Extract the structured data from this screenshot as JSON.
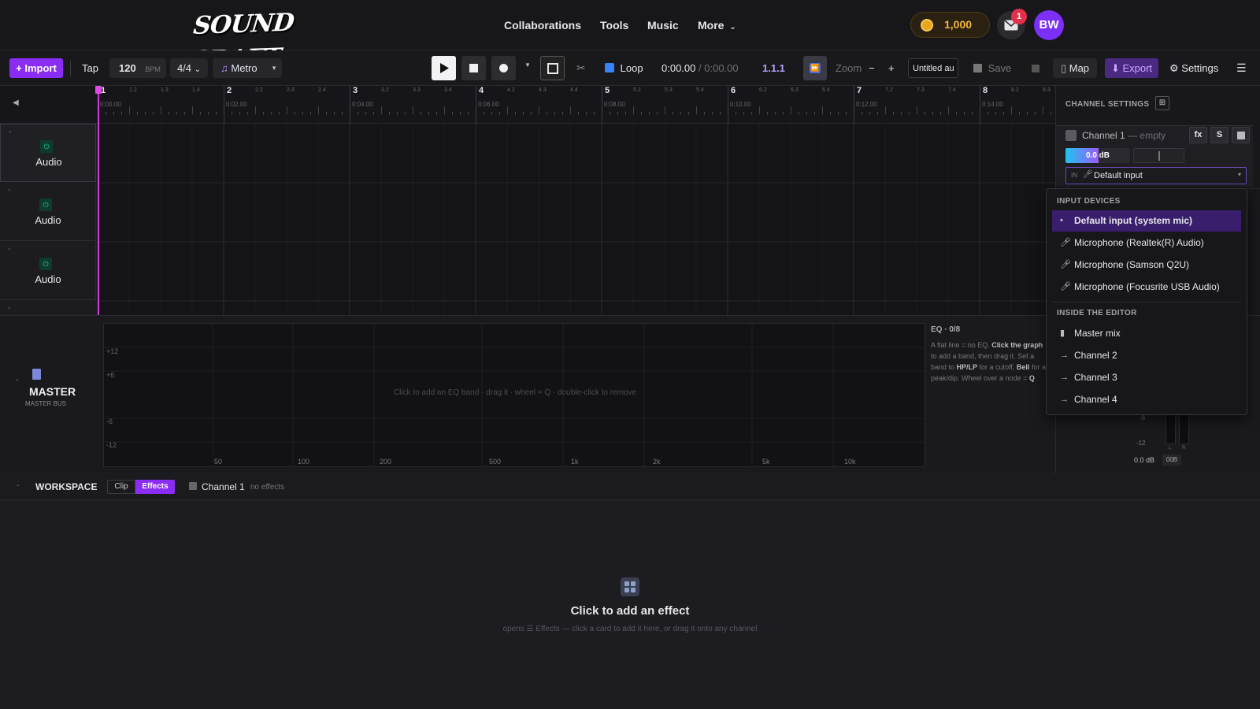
{
  "header": {
    "logo": "SOUND CRAFT",
    "nav": [
      "Collaborations",
      "Tools",
      "Music",
      "More"
    ],
    "coins": "1,000",
    "notifications": "1",
    "avatar": "BW"
  },
  "toolbar": {
    "import": "+ Import",
    "tap": "Tap",
    "bpm": "120",
    "bpm_unit": "BPM",
    "time_signature": "4/4",
    "metro": "Metro",
    "loop": "Loop",
    "time_current": "0:00.00",
    "time_sep": "/",
    "time_total": "0:00.00",
    "position": "1.1.1",
    "zoom": "Zoom",
    "zoom_out": "−",
    "zoom_in": "+",
    "project_name": "Untitled au",
    "save": "Save",
    "map": "Map",
    "export": "Export",
    "settings": "Settings"
  },
  "ruler": {
    "bars": [
      "1",
      "2",
      "3",
      "4",
      "5",
      "6",
      "7",
      "8"
    ],
    "subbeats": [
      "1.2",
      "1.3",
      "1.4",
      "2.2",
      "2.3",
      "2.4",
      "3.2",
      "3.3",
      "3.4",
      "4.2",
      "4.3",
      "4.4",
      "5.2",
      "5.3",
      "5.4",
      "6.2",
      "6.3",
      "6.4",
      "7.2",
      "7.3",
      "7.4",
      "8.2",
      "8.3"
    ],
    "times": [
      "0:00.00",
      "0:02.00",
      "0:04.00",
      "0:06.00",
      "0:08.00",
      "0:10.00",
      "0:12.00",
      "0:14.00"
    ],
    "collapse_arrow": "◀"
  },
  "tracks": [
    {
      "label": "Audio"
    },
    {
      "label": "Audio"
    },
    {
      "label": "Audio"
    }
  ],
  "channel_settings": {
    "title": "CHANNEL SETTINGS",
    "channel_name": "Channel 1",
    "channel_state": "— empty",
    "fx": "fx",
    "solo": "S",
    "volume": "0.0 dB",
    "input_prefix": "IN",
    "input_value": "Default input"
  },
  "input_dropdown": {
    "section1": "INPUT DEVICES",
    "devices": [
      "Default input (system mic)",
      "Microphone (Realtek(R) Audio)",
      "Microphone (Samson Q2U)",
      "Microphone (Focusrite USB Audio)"
    ],
    "section2": "INSIDE THE EDITOR",
    "editor_sources": [
      "Master mix",
      "Channel 2",
      "Channel 3",
      "Channel 4"
    ]
  },
  "master": {
    "title": "MASTER",
    "subtitle": "MASTER BUS",
    "eq_y_labels": [
      "+12",
      "+6",
      "-6",
      "-12"
    ],
    "eq_x_labels": [
      "50",
      "100",
      "200",
      "500",
      "1k",
      "2k",
      "5k",
      "10k"
    ],
    "eq_hint_line": "Click to add an EQ band · drag it · wheel = Q · double-click to remove",
    "eq_title": "EQ · 0/8",
    "eq_help": {
      "t1": "A flat line = no EQ. ",
      "b1": "Click the graph",
      "t2": " to add a band, then drag it. Set a band to ",
      "b2": "HP/LP",
      "t3": " for a cutoff, ",
      "b3": "Bell",
      "t4": " for a peak/dip. Wheel over a node = ",
      "b4": "Q"
    },
    "meter_labels": [
      "-6",
      "-12"
    ],
    "meter_lr": [
      "L",
      "R"
    ],
    "master_volume": "0.0 dB",
    "master_btn": "00B"
  },
  "workspace": {
    "title": "WORKSPACE",
    "tab_clip": "Clip",
    "tab_effects": "Effects",
    "channel": "Channel 1",
    "channel_state": "no effects",
    "empty_title": "Click to add an effect",
    "empty_hint": "opens ☰ Effects — click a card to add it here, or drag it onto any channel"
  },
  "colors": {
    "accent": "#8b2cf5",
    "playhead": "#d03ad8",
    "coin": "#f5b73c",
    "power_green": "#27d49a",
    "selected_item": "#3a1e6e"
  }
}
